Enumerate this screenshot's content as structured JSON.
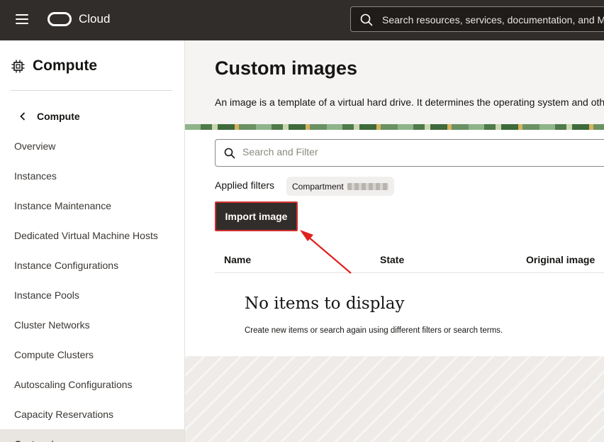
{
  "header": {
    "brand": "Cloud",
    "search_placeholder": "Search resources, services, documentation, and Marketplace"
  },
  "sidebar": {
    "title": "Compute",
    "back_label": "Compute",
    "items": [
      {
        "label": "Overview"
      },
      {
        "label": "Instances"
      },
      {
        "label": "Instance Maintenance"
      },
      {
        "label": "Dedicated Virtual Machine Hosts"
      },
      {
        "label": "Instance Configurations"
      },
      {
        "label": "Instance Pools"
      },
      {
        "label": "Cluster Networks"
      },
      {
        "label": "Compute Clusters"
      },
      {
        "label": "Autoscaling Configurations"
      },
      {
        "label": "Capacity Reservations"
      },
      {
        "label": "Custom Images"
      }
    ]
  },
  "main": {
    "title": "Custom images",
    "description": "An image is a template of a virtual hard drive. It determines the operating system and other software for an instance.",
    "filter_placeholder": "Search and Filter",
    "applied_filters_label": "Applied filters",
    "filter_chip_label": "Compartment",
    "import_button_label": "Import image",
    "columns": [
      "Name",
      "State",
      "Original image"
    ],
    "empty_title": "No items to display",
    "empty_description": "Create new items or search again using different filters or search terms."
  },
  "colors": {
    "header_bg": "#312d2a",
    "button_bg": "#312d2a",
    "highlight": "#d32f2f"
  }
}
